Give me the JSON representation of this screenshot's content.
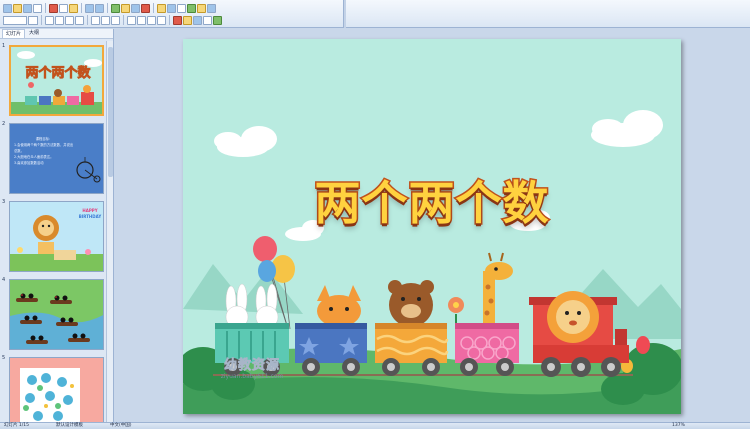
{
  "left_panel": {
    "tabs": [
      {
        "label": "幻灯片",
        "active": true
      },
      {
        "label": "大纲",
        "active": false
      }
    ],
    "thumbnails": [
      {
        "number": "1",
        "selected": true,
        "title": "两个两个数"
      },
      {
        "number": "2",
        "selected": false,
        "lines": [
          "课程目标：",
          "1.会使用两个两个数的方法数数，并说出总数。",
          "2.大胆地在众人面前表达。",
          "3.喜欢参加数数活动"
        ]
      },
      {
        "number": "3",
        "selected": false,
        "banner": [
          "HAPPY",
          "BIRTHDAY"
        ]
      },
      {
        "number": "4",
        "selected": false
      },
      {
        "number": "5",
        "selected": false
      }
    ]
  },
  "slide": {
    "title": "两个两个数",
    "watermark": "幼教资源",
    "watermark_url": "ziyuan.baby611.com"
  },
  "statusbar": {
    "slide_info": "幻灯片 1/15",
    "theme": "默认设计模板",
    "language": "中文(中国)",
    "zoom": "137%"
  },
  "colors": {
    "slide_background": "#b9ebe0",
    "title_fill": "#ffd23f",
    "title_outline": "#c2521c",
    "selected_thumbnail_border": "#f2a83b"
  }
}
